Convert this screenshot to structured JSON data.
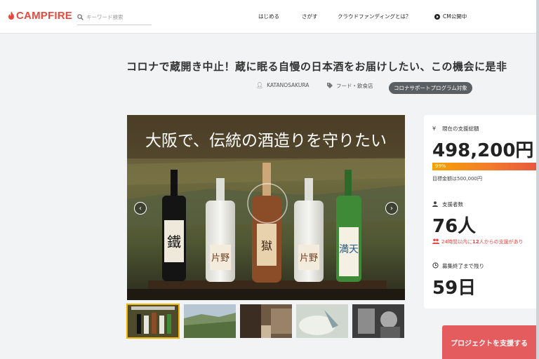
{
  "header": {
    "logo_text": "CAMPFIRE",
    "search_placeholder": "キーワード検索",
    "nav": [
      {
        "label": "はじめる"
      },
      {
        "label": "さがす"
      },
      {
        "label": "クラウドファンディングとは？"
      },
      {
        "label": "CM公開中"
      }
    ]
  },
  "project": {
    "title": "コロナで蔵開き中止！蔵に眠る自慢の日本酒をお届けしたい、この機会に是非",
    "owner": "KATANOSAKURA",
    "category": "フード・飲食店",
    "badge": "コロナサポートプログラム対象",
    "hero_caption": "大阪で、伝統の酒造りを守りたい"
  },
  "stats": {
    "funded_label": "現在の支援総額",
    "funded_amount": "498,200円",
    "progress_label": "99%",
    "progress_value": 0.99,
    "goal_text": "目標金額は500,000円",
    "backers_label": "支援者数",
    "backers_count": "76人",
    "recent_prefix": "24時間以内に",
    "recent_count": "12",
    "recent_suffix": "人からの支援があり",
    "remaining_label": "募集終了まで残り",
    "remaining_days": "59日"
  },
  "cta_label": "プロジェクトを支援する",
  "colors": {
    "brand": "#e8483f",
    "cta": "#e55c5f",
    "progress_start": "#f6a200",
    "progress_end": "#e8563e",
    "badge_bg": "#5a5f64"
  }
}
